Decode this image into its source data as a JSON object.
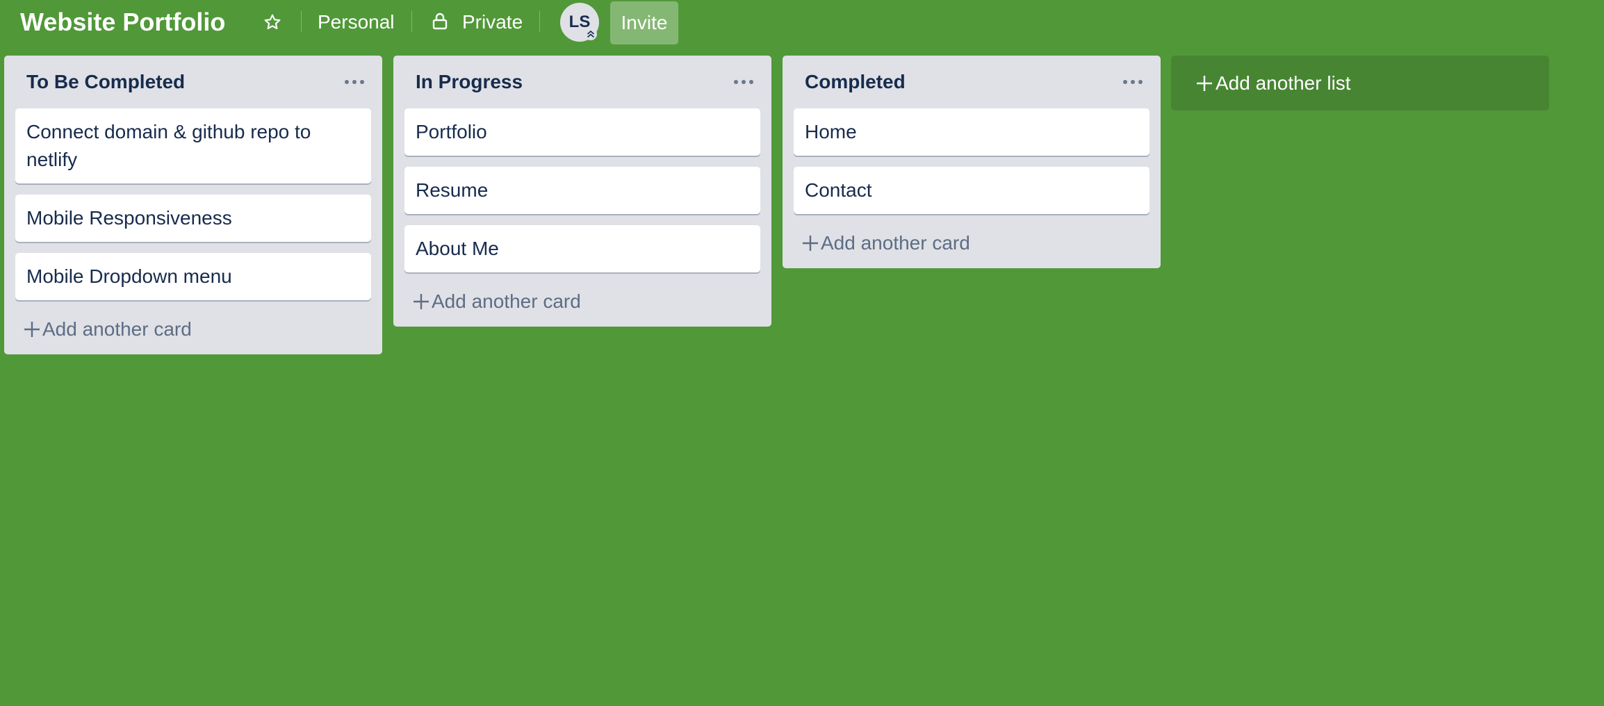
{
  "board": {
    "title": "Website Portfolio",
    "visibility_team": "Personal",
    "visibility_privacy": "Private",
    "member_initials": "LS",
    "invite_label": "Invite",
    "background_color": "#519839"
  },
  "lists": [
    {
      "title": "To Be Completed",
      "cards": [
        "Connect domain & github repo to netlify",
        "Mobile Responsiveness",
        "Mobile Dropdown menu"
      ],
      "add_card_label": "Add another card"
    },
    {
      "title": "In Progress",
      "cards": [
        "Portfolio",
        "Resume",
        "About Me"
      ],
      "add_card_label": "Add another card"
    },
    {
      "title": "Completed",
      "cards": [
        "Home",
        "Contact"
      ],
      "add_card_label": "Add another card"
    }
  ],
  "add_list_label": "Add another list",
  "icons": {
    "star": "star-icon",
    "lock": "lock-icon",
    "menu": "more-horizontal-icon",
    "plus": "plus-icon",
    "admin_badge": "chevron-up-double-icon"
  }
}
